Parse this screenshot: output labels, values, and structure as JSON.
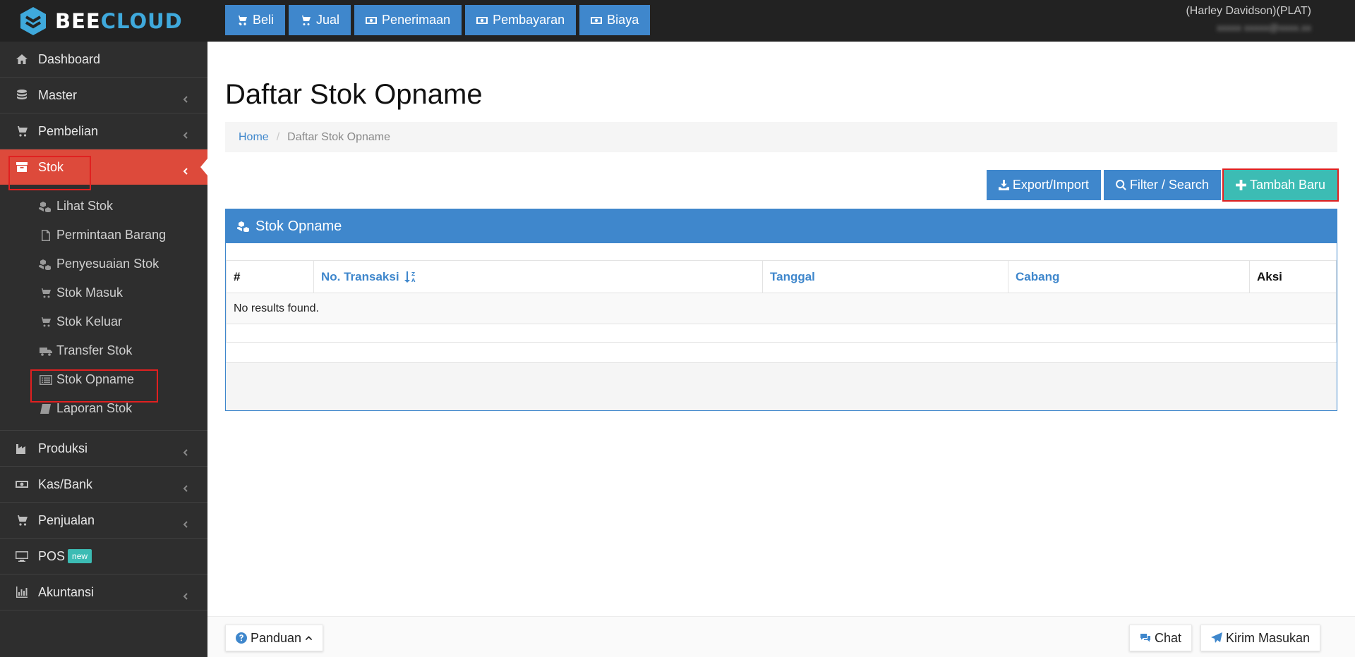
{
  "brand": {
    "part1": "BEE",
    "part2": "CLOUD"
  },
  "top_actions": [
    {
      "label": "Beli",
      "icon": "cart-icon"
    },
    {
      "label": "Jual",
      "icon": "cart-icon"
    },
    {
      "label": "Penerimaan",
      "icon": "money-icon"
    },
    {
      "label": "Pembayaran",
      "icon": "money-icon"
    },
    {
      "label": "Biaya",
      "icon": "money-icon"
    }
  ],
  "company": {
    "name": "(Harley Davidson)(PLAT)"
  },
  "sidebar": {
    "items": [
      {
        "label": "Dashboard",
        "icon": "home-icon"
      },
      {
        "label": "Master",
        "icon": "database-icon"
      },
      {
        "label": "Pembelian",
        "icon": "cart-icon"
      },
      {
        "label": "Stok",
        "icon": "archive-icon"
      },
      {
        "label": "Produksi",
        "icon": "factory-icon"
      },
      {
        "label": "Kas/Bank",
        "icon": "money-icon"
      },
      {
        "label": "Penjualan",
        "icon": "cart-icon"
      },
      {
        "label": "POS",
        "icon": "desktop-icon",
        "badge": "new"
      },
      {
        "label": "Akuntansi",
        "icon": "bar-chart-icon"
      }
    ],
    "stok_sub": [
      {
        "label": "Lihat Stok",
        "icon": "cubes-icon"
      },
      {
        "label": "Permintaan Barang",
        "icon": "file-icon"
      },
      {
        "label": "Penyesuaian Stok",
        "icon": "cubes-icon"
      },
      {
        "label": "Stok Masuk",
        "icon": "cart-icon"
      },
      {
        "label": "Stok Keluar",
        "icon": "cart-icon"
      },
      {
        "label": "Transfer Stok",
        "icon": "truck-icon"
      },
      {
        "label": "Stok Opname",
        "icon": "list-icon"
      },
      {
        "label": "Laporan Stok",
        "icon": "book-icon"
      }
    ]
  },
  "page": {
    "title": "Daftar Stok Opname",
    "breadcrumb": {
      "home": "Home",
      "sep": "/",
      "current": "Daftar Stok Opname"
    }
  },
  "actions": {
    "export": "Export/Import",
    "filter": "Filter / Search",
    "add": "Tambah Baru"
  },
  "panel": {
    "title": "Stok Opname",
    "columns": [
      "#",
      "No. Transaksi",
      "Tanggal",
      "Cabang",
      "Aksi"
    ],
    "empty_text": "No results found."
  },
  "footer": {
    "guide": "Panduan",
    "chat": "Chat",
    "feedback": "Kirim Masukan"
  },
  "colors": {
    "primary": "#3f87cc",
    "active": "#dd4a3b",
    "teal": "#3cbcb4",
    "sidebar": "#2e2e2e",
    "topbar": "#222222"
  }
}
